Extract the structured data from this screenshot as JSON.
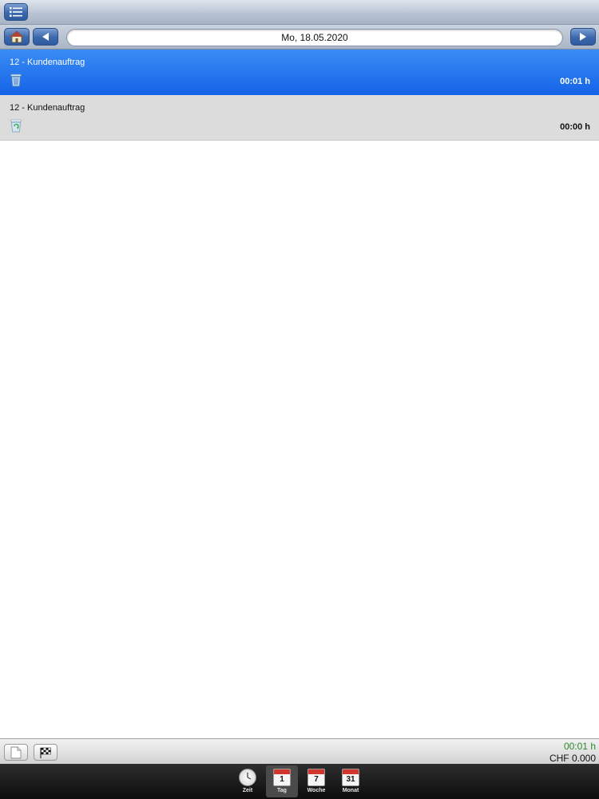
{
  "header": {
    "menu_icon": "list-icon",
    "home_icon": "home-icon",
    "prev_icon": "triangle-left-icon",
    "next_icon": "triangle-right-icon",
    "date": "Mo, 18.05.2020"
  },
  "entries": [
    {
      "title": "12 - Kundenauftrag",
      "duration": "00:01 h",
      "icon": "trash-icon",
      "selected": true
    },
    {
      "title": "12 - Kundenauftrag",
      "duration": "00:00 h",
      "icon": "recycle-trash-icon",
      "selected": false
    }
  ],
  "footer": {
    "new_icon": "document-icon",
    "flag_icon": "checkered-flag-icon",
    "total_time": "00:01 h",
    "total_amount": "CHF 0.000"
  },
  "tabs": [
    {
      "label": "Zeit",
      "icon": "clock-icon",
      "active": false
    },
    {
      "label": "Tag",
      "icon": "calendar-icon",
      "cal_number": "1",
      "active": true
    },
    {
      "label": "Woche",
      "icon": "calendar-icon",
      "cal_number": "7",
      "active": false
    },
    {
      "label": "Monat",
      "icon": "calendar-icon",
      "cal_number": "31",
      "active": false
    }
  ],
  "colors": {
    "selected_row": "#1f6fee",
    "total_time": "#2a8a2a",
    "calendar_header": "#d2352b"
  }
}
